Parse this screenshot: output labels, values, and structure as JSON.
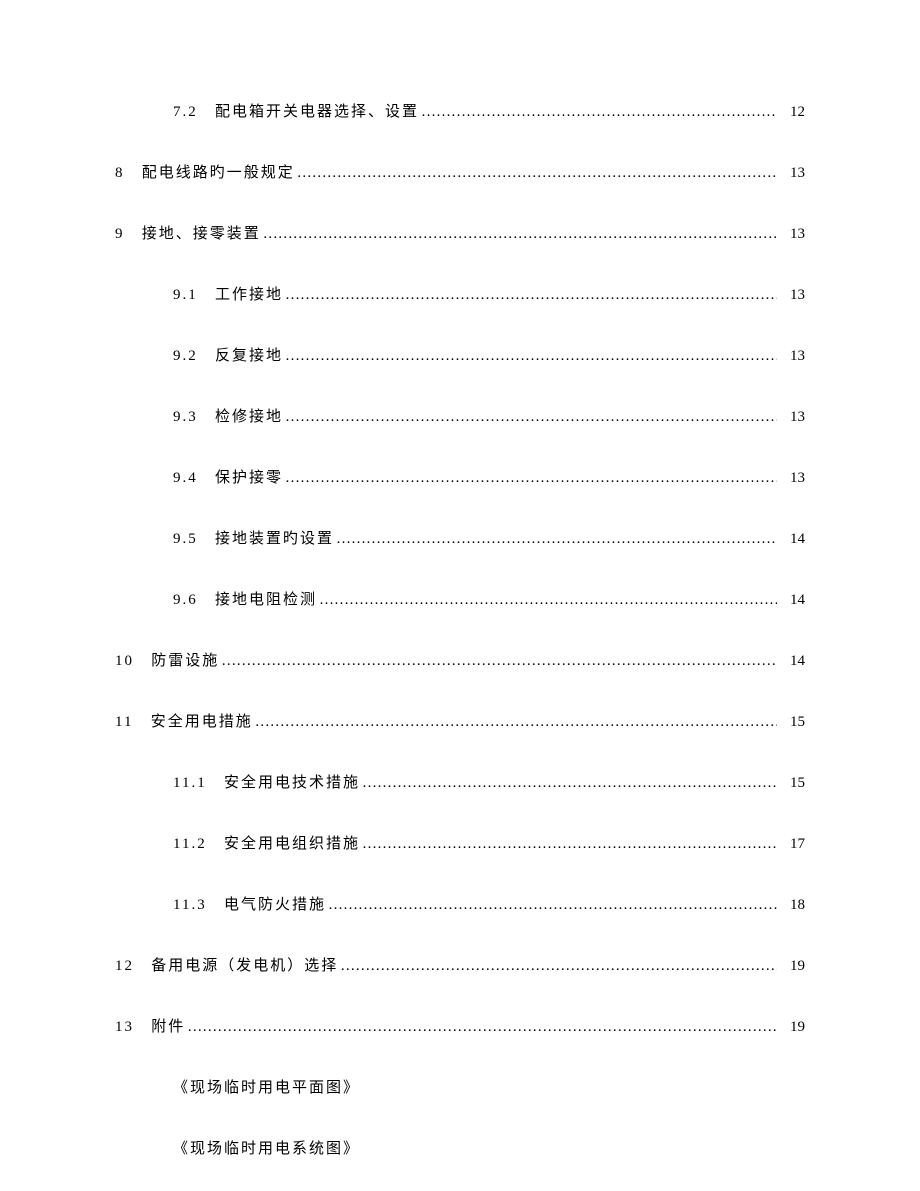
{
  "toc": [
    {
      "level": 2,
      "num": "7.2",
      "title": "配电箱开关电器选择、设置",
      "page": "12"
    },
    {
      "level": 1,
      "num": "8",
      "title": "配电线路旳一般规定",
      "page": "13"
    },
    {
      "level": 1,
      "num": "9",
      "title": "接地、接零装置",
      "page": "13"
    },
    {
      "level": 2,
      "num": "9.1",
      "title": "工作接地",
      "page": "13"
    },
    {
      "level": 2,
      "num": "9.2",
      "title": "反复接地",
      "page": "13"
    },
    {
      "level": 2,
      "num": "9.3",
      "title": "检修接地",
      "page": "13"
    },
    {
      "level": 2,
      "num": "9.4",
      "title": "保护接零",
      "page": "13"
    },
    {
      "level": 2,
      "num": "9.5",
      "title": "接地装置旳设置",
      "page": "14"
    },
    {
      "level": 2,
      "num": "9.6",
      "title": "接地电阻检测",
      "page": "14"
    },
    {
      "level": 1,
      "num": "10",
      "title": "防雷设施",
      "page": "14"
    },
    {
      "level": 1,
      "num": "11",
      "title": "安全用电措施",
      "page": "15"
    },
    {
      "level": 2,
      "num": "11.1",
      "title": "安全用电技术措施",
      "page": "15"
    },
    {
      "level": 2,
      "num": "11.2",
      "title": "安全用电组织措施",
      "page": "17"
    },
    {
      "level": 2,
      "num": "11.3",
      "title": "电气防火措施",
      "page": "18"
    },
    {
      "level": 1,
      "num": "12",
      "title": "备用电源（发电机）选择",
      "page": "19"
    },
    {
      "level": 1,
      "num": "13",
      "title": "附件",
      "page": "19"
    }
  ],
  "appendix": [
    "《现场临时用电平面图》",
    "《现场临时用电系统图》"
  ]
}
